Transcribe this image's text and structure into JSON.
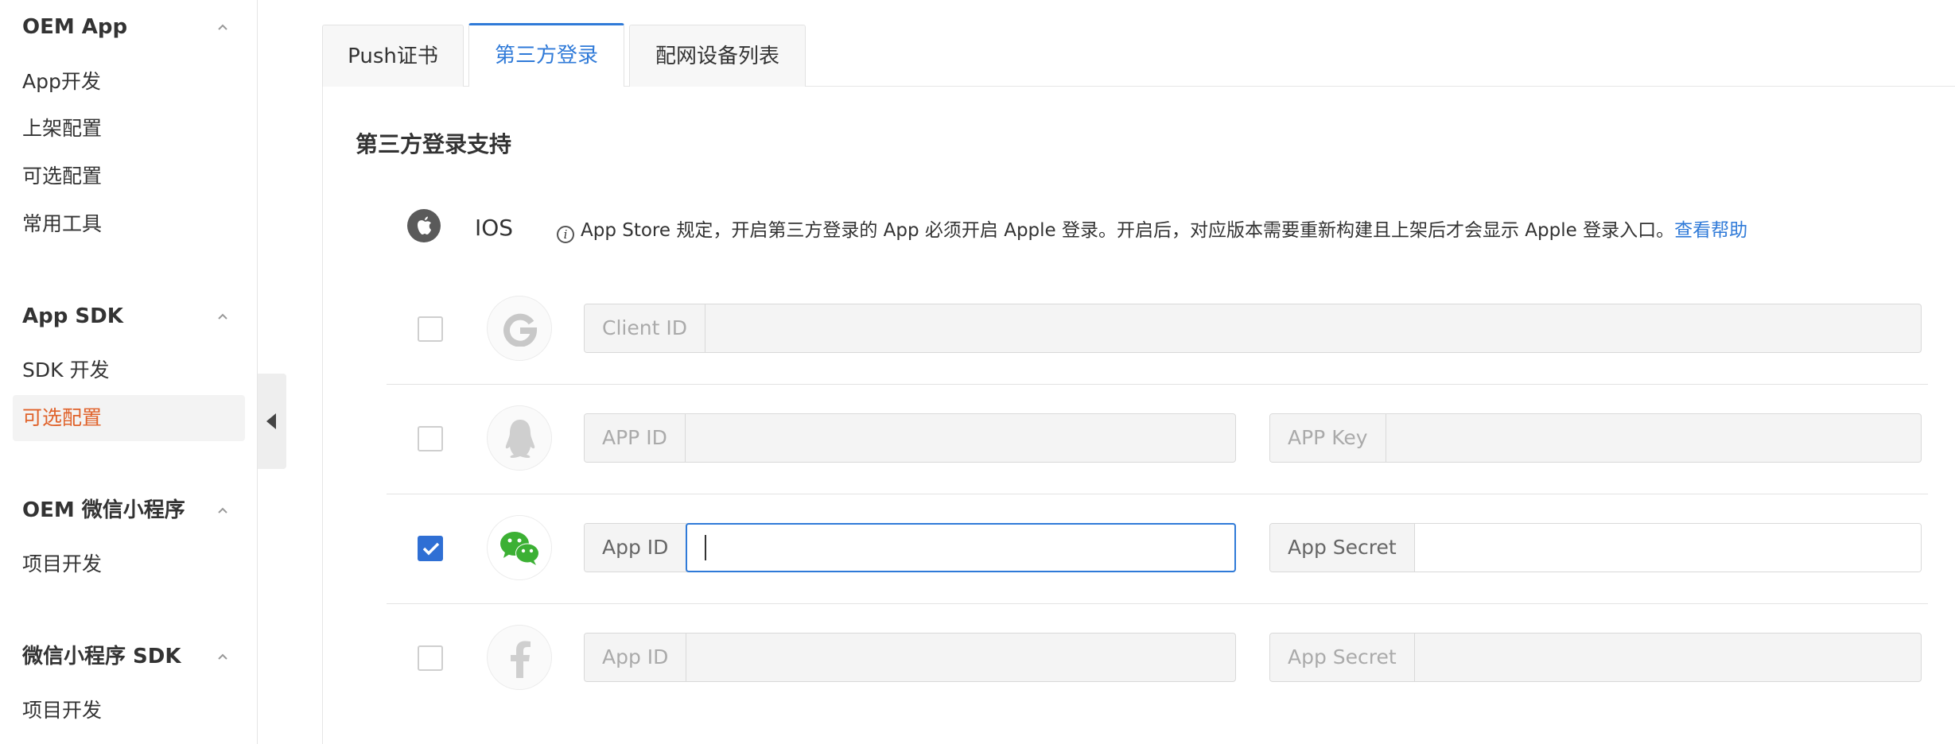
{
  "sidebar": {
    "groups": [
      {
        "title": "OEM App",
        "items": [
          "App开发",
          "上架配置",
          "可选配置",
          "常用工具"
        ]
      },
      {
        "title": "App SDK",
        "items": [
          "SDK 开发",
          "可选配置"
        ]
      },
      {
        "title": "OEM 微信小程序",
        "items": [
          "项目开发"
        ]
      },
      {
        "title": "微信小程序 SDK",
        "items": [
          "项目开发"
        ]
      }
    ],
    "active_item": "App SDK / 可选配置"
  },
  "tabs": [
    {
      "label": "Push证书"
    },
    {
      "label": "第三方登录"
    },
    {
      "label": "配网设备列表"
    }
  ],
  "active_tab": "第三方登录",
  "section": {
    "title": "第三方登录支持",
    "platform": "IOS",
    "notice": "App Store 规定，开启第三方登录的 App 必须开启 Apple 登录。开启后，对应版本需要重新构建且上架后才会显示 Apple 登录入口。",
    "help_link": "查看帮助"
  },
  "providers": {
    "google": {
      "checked": false,
      "icon": "google-icon",
      "field1_label": "Client ID",
      "field1_value": ""
    },
    "qq": {
      "checked": false,
      "icon": "qq-penguin-icon",
      "field1_label": "APP ID",
      "field1_value": "",
      "field2_label": "APP Key",
      "field2_value": ""
    },
    "wechat": {
      "checked": true,
      "icon": "wechat-icon",
      "field1_label": "App ID",
      "field1_value": "",
      "field2_label": "App Secret",
      "field2_value": ""
    },
    "facebook": {
      "checked": false,
      "icon": "facebook-icon",
      "field1_label": "App ID",
      "field1_value": "",
      "field2_label": "App Secret",
      "field2_value": ""
    }
  },
  "colors": {
    "accent": "#2f7ad8",
    "active_nav": "#e0622a",
    "checkbox_checked": "#2f6fd4",
    "wechat_green": "#3cb034"
  }
}
